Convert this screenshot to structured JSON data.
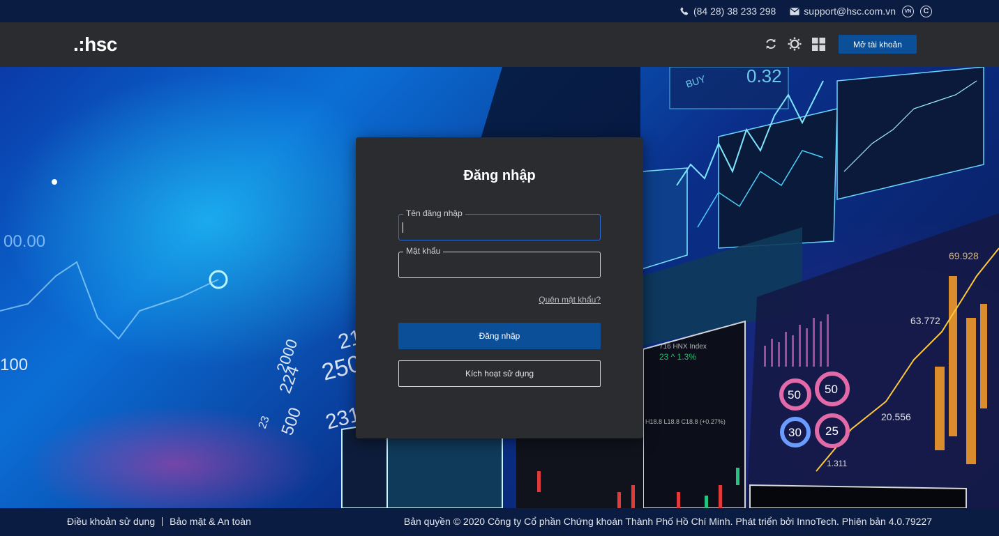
{
  "topbar": {
    "phone": "(84 28) 38 233 298",
    "email": "support@hsc.com.vn",
    "lang_badge": "VN",
    "copyright_badge": "C",
    "phone_icon": "phone-icon",
    "email_icon": "envelope-icon"
  },
  "header": {
    "logo": ".:hsc",
    "icons": [
      "refresh-icon",
      "sun-icon",
      "grid-icon"
    ],
    "open_account_label": "Mở tài khoản"
  },
  "login": {
    "title": "Đăng nhập",
    "username_label": "Tên đăng nhập",
    "username_value": "",
    "password_label": "Mật khẩu",
    "password_value": "",
    "forgot_label": "Quên mật khẩu?",
    "submit_label": "Đăng nhập",
    "activate_label": "Kích hoạt sử dụng"
  },
  "footer": {
    "terms_label": "Điều khoản sử dụng",
    "security_label": "Bảo mật & An toàn",
    "copyright": "Bản quyền © 2020 Công ty Cổ phần Chứng khoán Thành Phố Hồ Chí Minh. Phát triển bởi InnoTech. Phiên bản 4.0.79227"
  },
  "hero": {
    "numbers": [
      "0.32",
      "69.928",
      "63.772",
      "20.556",
      "1.311",
      "50",
      "50",
      "30",
      "25",
      "BUY",
      "HNX Index",
      "1.3%",
      "250",
      "215",
      "2000",
      "224",
      "500",
      "231",
      "23",
      "716",
      "H18.8 L18.8 C18.8 (+0.27%)",
      "00.00",
      "100"
    ],
    "colors": {
      "card_bg": "#2b2c30",
      "accent": "#0c4f99",
      "topbar_bg": "#0a1c42"
    }
  }
}
